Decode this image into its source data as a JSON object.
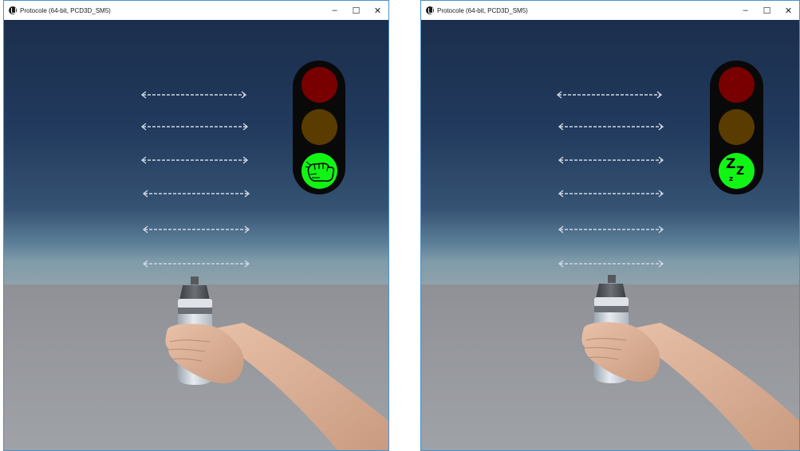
{
  "windows": [
    {
      "title": "Protocole (64-bit, PCD3D_SM5)",
      "controls": {
        "minimize": "–",
        "maximize": "☐",
        "close": "✕"
      },
      "traffic_light": {
        "red": "off",
        "yellow": "off",
        "green": "on",
        "green_icon": "fist-icon"
      }
    },
    {
      "title": "Protocole (64-bit, PCD3D_SM5)",
      "controls": {
        "minimize": "–",
        "maximize": "☐",
        "close": "✕"
      },
      "traffic_light": {
        "red": "off",
        "yellow": "off",
        "green": "on",
        "green_icon": "sleep-zzz-icon",
        "green_text": "Z z z"
      }
    }
  ],
  "colors": {
    "window_border": "#4a90c8",
    "light_red_off": "#780000",
    "light_yellow_off": "#5a3c00",
    "light_green_on": "#11f515",
    "housing": "#090909"
  }
}
